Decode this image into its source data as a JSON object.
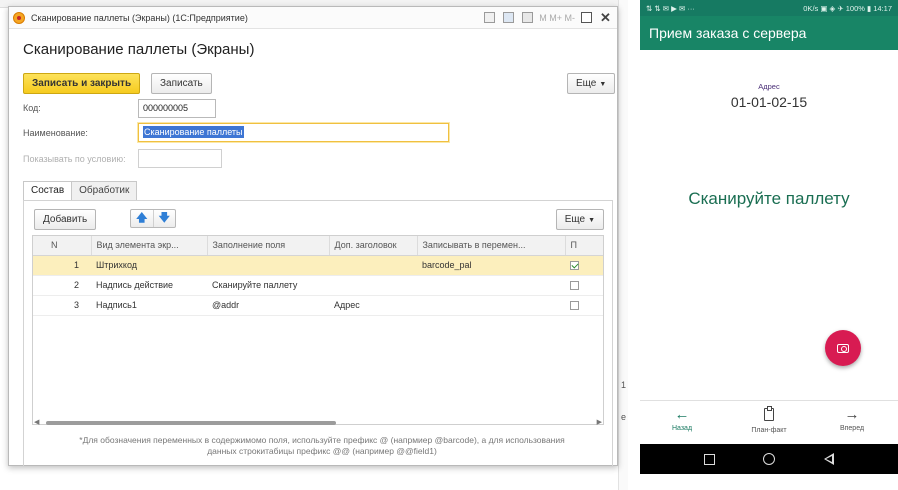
{
  "window": {
    "title": "Сканирование паллеты (Экраны) (1С:Предприятие)",
    "toolbar_text": "M  M+  M-"
  },
  "form": {
    "title": "Сканирование паллеты (Экраны)",
    "save_close_label": "Записать и закрыть",
    "save_label": "Записать",
    "more_label": "Еще",
    "code_label": "Код:",
    "code_value": "000000005",
    "name_label": "Наименование:",
    "name_value": "Сканирование паллеты",
    "condition_label": "Показывать по условию:",
    "condition_value": ""
  },
  "tabs": [
    {
      "label": "Состав"
    },
    {
      "label": "Обработик"
    }
  ],
  "table": {
    "add_label": "Добавить",
    "more_label": "Еще",
    "columns": [
      "N",
      "Вид элемента экр...",
      "Заполнение поля",
      "Доп. заголовок",
      "Записывать в перемен...",
      "П"
    ],
    "rows": [
      {
        "n": "1",
        "kind": "Штрихкод",
        "fill": "",
        "extra": "",
        "var": "barcode_pal",
        "checked": true
      },
      {
        "n": "2",
        "kind": "Надпись действие",
        "fill": "Сканируйте паллету",
        "extra": "",
        "var": "",
        "checked": false
      },
      {
        "n": "3",
        "kind": "Надпись1",
        "fill": "@addr",
        "extra": "Адрес",
        "var": "",
        "checked": false
      }
    ],
    "hint_line1": "*Для обозначения переменных в содержимомо поля, используйте префикс @ (напрмиер @barcode), а для использования",
    "hint_line2": "данных строкитабицы префикс @@ (например @@field1)"
  },
  "phone": {
    "status_left": "⇅ ⇅ ✉ ▶ ✉ ···",
    "status_right": "0K/s ▣ ◈ ✈ 100% ▮ 14:17",
    "app_title": "Прием заказа с сервера",
    "addr_label": "Адрес",
    "addr_value": "01-01-02-15",
    "scan_prompt": "Сканируйте паллету",
    "nav_back": "Назад",
    "nav_plan": "План-факт",
    "nav_next": "Вперед"
  },
  "colors": {
    "accent_yellow": "#f6cb1f",
    "selection_row": "#fcefbd",
    "app_green": "#188566",
    "fab_pink": "#d81b52"
  },
  "icons": [
    "app-logo-icon",
    "arrow-up-icon",
    "arrow-down-icon",
    "camera-icon",
    "arrow-left-icon",
    "clipboard-icon",
    "arrow-right-icon"
  ]
}
